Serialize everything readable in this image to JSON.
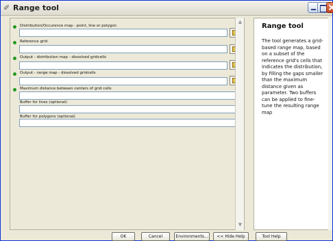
{
  "window": {
    "title": "Range tool",
    "title_icon": "tool-icon"
  },
  "parameters": [
    {
      "label": "Distribution/Occurence map - point, line or polygon",
      "required": true,
      "has_browse": true,
      "value": ""
    },
    {
      "label": "Reference grid",
      "required": true,
      "has_browse": true,
      "value": ""
    },
    {
      "label": "Output - distribution map - dissolved gridcells",
      "required": true,
      "has_browse": true,
      "value": ""
    },
    {
      "label": "Output - range map - dissolved gridcells",
      "required": true,
      "has_browse": true,
      "value": ""
    },
    {
      "label": "Maximum distance between centers of grid cells",
      "required": true,
      "has_browse": false,
      "value": ""
    },
    {
      "label": "Buffer for lines (optional)",
      "required": false,
      "has_browse": false,
      "value": ""
    },
    {
      "label": "Buffer for polygons (optional)",
      "required": false,
      "has_browse": false,
      "value": ""
    }
  ],
  "help": {
    "title": "Range tool",
    "body": "The tool generates a grid-based range map, based on a subset of the reference grid's cells that indicates the distribution, by filling the gaps smaller than the maximum distance given as parameter. Two buffers can be applied to fine-tune the resulting range map"
  },
  "buttons": {
    "ok": "OK",
    "cancel": "Cancel",
    "environments": "Environments...",
    "hide_help": "<< Hide Help",
    "tool_help": "Tool Help"
  },
  "colors": {
    "required_dot": "#1e9a1e",
    "input_border": "#7f9db9",
    "window_bg": "#ece9d8"
  }
}
